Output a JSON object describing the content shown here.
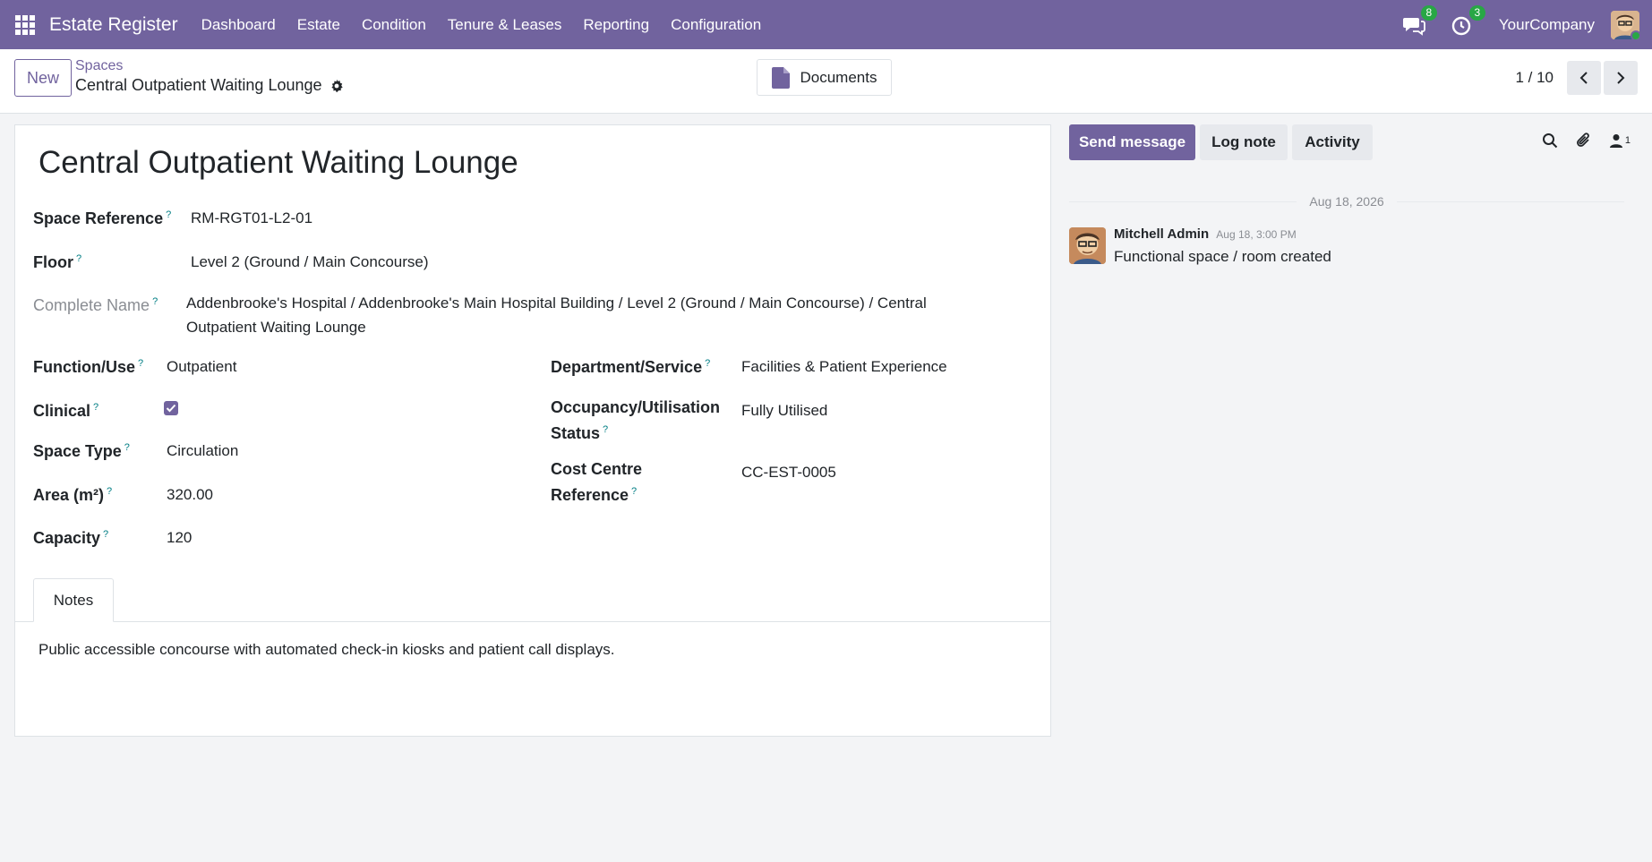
{
  "navbar": {
    "app_name": "Estate Register",
    "menu": [
      "Dashboard",
      "Estate",
      "Condition",
      "Tenure & Leases",
      "Reporting",
      "Configuration"
    ],
    "messages_count": "8",
    "activities_count": "3",
    "company": "YourCompany",
    "color": "#71639e"
  },
  "control": {
    "new_label": "New",
    "breadcrumb_parent": "Spaces",
    "breadcrumb_current": "Central Outpatient Waiting Lounge",
    "documents_label": "Documents",
    "pager": "1 / 10"
  },
  "record": {
    "title": "Central Outpatient Waiting Lounge",
    "space_reference_label": "Space Reference",
    "space_reference": "RM-RGT01-L2-01",
    "floor_label": "Floor",
    "floor": "Level 2 (Ground / Main Concourse)",
    "complete_name_label": "Complete Name",
    "complete_name_line1": "Addenbrooke's Hospital / Addenbrooke's Main Hospital Building / Level 2 (Ground / Main Concourse) / Central",
    "complete_name_line2": "Outpatient Waiting Lounge",
    "function_label": "Function/Use",
    "function": "Outpatient",
    "clinical_label": "Clinical",
    "clinical": true,
    "space_type_label": "Space Type",
    "space_type": "Circulation",
    "area_label": "Area (m²)",
    "area": "320.00",
    "capacity_label": "Capacity",
    "capacity": "120",
    "department_label": "Department/Service",
    "department": "Facilities & Patient Experience",
    "occupancy_label_line1": "Occupancy/Utilisation",
    "occupancy_label_line2": "Status",
    "occupancy": "Fully Utilised",
    "cost_centre_label_line1": "Cost Centre",
    "cost_centre_label_line2": "Reference",
    "cost_centre": "CC-EST-0005",
    "help_marker": "?"
  },
  "notes": {
    "tab_label": "Notes",
    "text": "Public accessible concourse with automated check-in kiosks and patient call displays."
  },
  "chatter": {
    "send_message": "Send message",
    "log_note": "Log note",
    "activity": "Activity",
    "followers_count": "1",
    "date_separator": "Aug 18, 2026",
    "message": {
      "author": "Mitchell Admin",
      "time": "Aug 18, 3:00 PM",
      "body": "Functional space / room created"
    }
  }
}
